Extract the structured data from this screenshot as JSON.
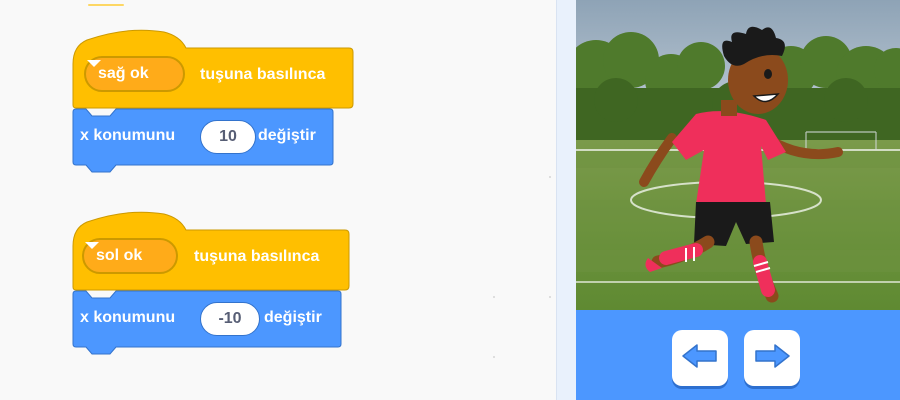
{
  "scripts": [
    {
      "hat": {
        "key_option": "sağ ok",
        "label": "tuşuna basılınca"
      },
      "motion": {
        "label_before": "x konumunu",
        "value": "10",
        "label_after": "değiştir"
      }
    },
    {
      "hat": {
        "key_option": "sol ok",
        "label": "tuşuna basılınca"
      },
      "motion": {
        "label_before": "x konumunu",
        "value": "-10",
        "label_after": "değiştir"
      }
    }
  ],
  "controls": {
    "left_icon": "left-arrow-icon",
    "right_icon": "right-arrow-icon"
  },
  "colors": {
    "events": "#ffbf00",
    "events_border": "#cc9900",
    "motion": "#4c97ff",
    "motion_border": "#3373cc",
    "stage_panel": "#4c97ff",
    "button_arrow": "#4c97ff"
  },
  "stage": {
    "sprite": "soccer-player",
    "backdrop": "soccer-field"
  }
}
